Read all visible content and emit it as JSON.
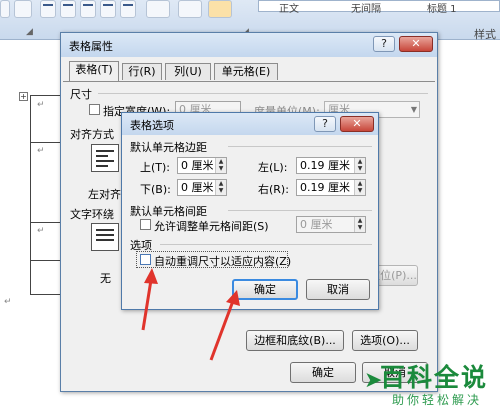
{
  "ribbon": {
    "style_labels": [
      "正文",
      "无间隔",
      "标题 1"
    ],
    "right_tab": "样式"
  },
  "doc": {
    "paragraph_mark": "↵",
    "left_mark": "↵"
  },
  "outer": {
    "title": "表格属性",
    "help": "?",
    "close": "✕",
    "tabs": [
      "表格(T)",
      "行(R)",
      "列(U)",
      "单元格(E)"
    ],
    "size_section": "尺寸",
    "preferred_width_label": "指定宽度(W):",
    "preferred_width_value": "0 厘米",
    "measure_label": "度量单位(M):",
    "measure_value": "厘米",
    "align_section": "对齐方式",
    "align_left_label": "左对齐",
    "wrap_section": "文字环绕",
    "wrap_none_label": "无",
    "positioning_button": "定位(P)...",
    "borders_button": "边框和底纹(B)...",
    "options_button": "选项(O)...",
    "ok_button": "确定",
    "cancel_button": "取消"
  },
  "inner": {
    "title": "表格选项",
    "help": "?",
    "close": "✕",
    "margins_section": "默认单元格边距",
    "top_label": "上(T):",
    "top_value": "0 厘米",
    "left_label": "左(L):",
    "left_value": "0.19 厘米",
    "bottom_label": "下(B):",
    "bottom_value": "0 厘米",
    "right_label": "右(R):",
    "right_value": "0.19 厘米",
    "spacing_section": "默认单元格间距",
    "allow_spacing_label": "允许调整单元格间距(S)",
    "spacing_value": "0 厘米",
    "options_section": "选项",
    "autoresize_label": "自动重调尺寸以适应内容(Z)",
    "autoresize_checked": false,
    "ok_button": "确定",
    "cancel_button": "取消"
  },
  "watermark": {
    "title": "百科全说",
    "subtitle": "助你轻松解决"
  },
  "colors": {
    "annotation_red": "#e0342c",
    "dialog_border": "#5a7fa8",
    "default_button_blue": "#3a8ae0",
    "watermark_green": "#1b8a3c"
  }
}
